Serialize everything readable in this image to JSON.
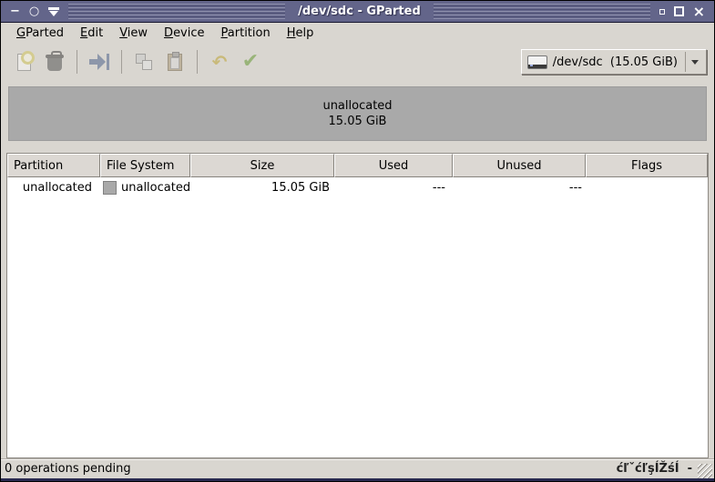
{
  "window": {
    "title": "/dev/sdc - GParted",
    "controls": {
      "minimize_glyph": "−",
      "circle_glyph": "○",
      "close_glyph": "×"
    }
  },
  "menubar": {
    "items": [
      {
        "mnemonic": "G",
        "rest": "Parted"
      },
      {
        "mnemonic": "E",
        "rest": "dit"
      },
      {
        "mnemonic": "V",
        "rest": "iew"
      },
      {
        "mnemonic": "D",
        "rest": "evice"
      },
      {
        "mnemonic": "P",
        "rest": "artition"
      },
      {
        "mnemonic": "H",
        "rest": "elp"
      }
    ]
  },
  "toolbar": {
    "buttons": [
      "new-partition",
      "delete-partition",
      "resize-move",
      "copy-partition",
      "paste-partition",
      "undo",
      "apply"
    ],
    "undo_glyph": "↶",
    "apply_glyph": "✔",
    "device_selector": {
      "device": "/dev/sdc",
      "size": "(15.05 GiB)"
    }
  },
  "disk_view": {
    "partition_label": "unallocated",
    "partition_size": "15.05 GiB",
    "bar_color": "#a9a9a9"
  },
  "partition_table": {
    "columns": [
      "Partition",
      "File System",
      "Size",
      "Used",
      "Unused",
      "Flags"
    ],
    "rows": [
      {
        "partition": "unallocated",
        "filesystem": "unallocated",
        "swatch_color": "#a9a9a9",
        "size": "15.05 GiB",
        "used": "---",
        "unused": "---",
        "flags": ""
      }
    ]
  },
  "statusbar": {
    "pending": "0 operations pending",
    "overlay_text": "ćľˇćľşÍŽśÍ  -"
  },
  "colors": {
    "titlebar": "#63658a",
    "window_bg": "#d9d6d0",
    "unallocated_gray": "#a9a9a9",
    "apply_green": "#4e9a06",
    "undo_yellow": "#c4a000",
    "arrow_blue": "#3c5a96"
  }
}
